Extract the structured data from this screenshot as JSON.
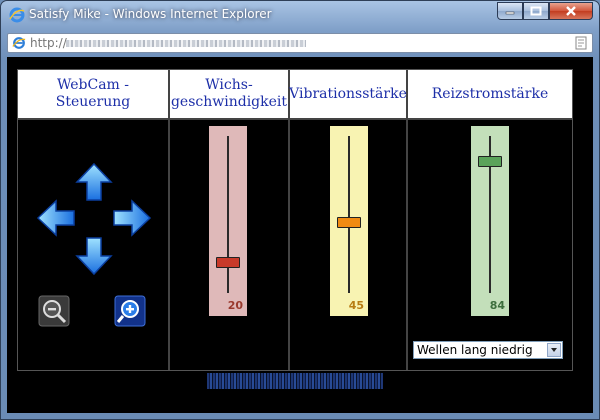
{
  "window": {
    "title": "Satisfy Mike - Windows Internet Explorer"
  },
  "address": {
    "url_prefix": "http://"
  },
  "panels": {
    "webcam": {
      "title": "WebCam - Steuerung"
    },
    "speed": {
      "title_line1": "Wichs-",
      "title_line2": "geschwindigkeit",
      "value": "20"
    },
    "vibration": {
      "title": "Vibrationsstärke",
      "value": "45"
    },
    "current": {
      "title": "Reizstromstärke",
      "value": "84",
      "mode": "Wellen lang niedrig"
    }
  },
  "colors": {
    "speed_track": "#dfb9b9",
    "speed_thumb": "#c83a2a",
    "speed_value": "#9a3a2e",
    "vibration_track": "#f8f3b2",
    "vibration_thumb": "#f08a12",
    "vibration_value": "#b87d14",
    "current_track": "#c3dfba",
    "current_thumb": "#5aa35a",
    "current_value": "#3d6f3d",
    "header_text": "#1d2fa8"
  },
  "icons": [
    "arrow-up-icon",
    "arrow-down-icon",
    "arrow-left-icon",
    "arrow-right-icon",
    "zoom-out-icon",
    "zoom-in-icon"
  ]
}
